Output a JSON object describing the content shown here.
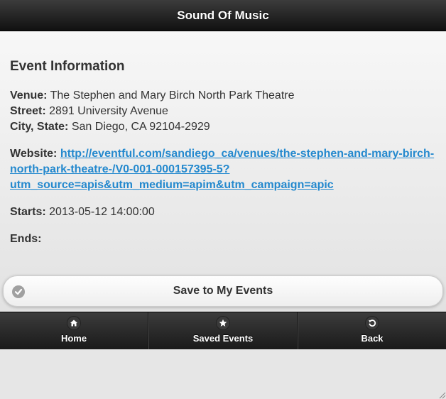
{
  "header": {
    "title": "Sound Of Music"
  },
  "event": {
    "section_title": "Event Information",
    "venue_label": "Venue:",
    "venue": "The Stephen and Mary Birch North Park Theatre",
    "street_label": "Street:",
    "street": "2891 University Avenue",
    "city_state_label": "City, State:",
    "city_state": "San Diego, CA 92104-2929",
    "website_label": "Website:",
    "website_line1": "http://eventful.com/sandiego_ca/venues/the-stephen-and-mary-birch-",
    "website_line2": "north-park-theatre-/V0-001-000157395-5?",
    "website_line3": "utm_source=apis&utm_medium=apim&utm_campaign=apic",
    "starts_label": "Starts:",
    "starts": "2013-05-12 14:00:00",
    "ends_label": "Ends:",
    "ends": ""
  },
  "save_button": {
    "label": "Save to My Events",
    "icon": "check-icon"
  },
  "navbar": {
    "items": [
      {
        "label": "Home",
        "icon": "home-icon"
      },
      {
        "label": "Saved Events",
        "icon": "star-icon"
      },
      {
        "label": "Back",
        "icon": "back-icon"
      }
    ]
  },
  "colors": {
    "header_bg": "#1a1a1a",
    "link": "#2489ce",
    "content_bg": "#e6e6e6"
  }
}
